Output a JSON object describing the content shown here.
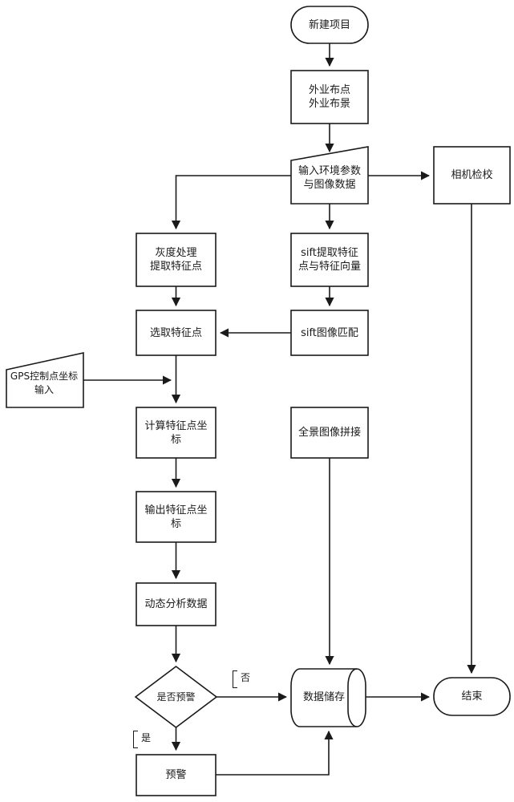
{
  "diagram": {
    "title": "Photogrammetry monitoring workflow flowchart",
    "stroke_color": "#1a1a1a",
    "fill_color": "#ffffff",
    "nodes": [
      {
        "id": "start",
        "label": "新建项目",
        "shape": "terminator"
      },
      {
        "id": "layout",
        "label": "外业布点\n外业布景",
        "shape": "process"
      },
      {
        "id": "input",
        "label": "输入环境参数\n与图像数据",
        "shape": "trapezoid"
      },
      {
        "id": "camera",
        "label": "相机检校",
        "shape": "process"
      },
      {
        "id": "gray",
        "label": "灰度处理\n提取特征点",
        "shape": "process"
      },
      {
        "id": "siftext",
        "label": "sift提取特征\n点与特征向量",
        "shape": "process"
      },
      {
        "id": "select",
        "label": "选取特征点",
        "shape": "process"
      },
      {
        "id": "siftmatch",
        "label": "sift图像匹配",
        "shape": "process"
      },
      {
        "id": "gps",
        "label": "GPS控制点坐标\n输入",
        "shape": "trapezoid"
      },
      {
        "id": "calc",
        "label": "计算特征点坐\n标",
        "shape": "process"
      },
      {
        "id": "output",
        "label": "输出特征点坐\n标",
        "shape": "process"
      },
      {
        "id": "panorama",
        "label": "全景图像拼接",
        "shape": "process"
      },
      {
        "id": "dynamic",
        "label": "动态分析数据",
        "shape": "process"
      },
      {
        "id": "decision",
        "label": "是否预警",
        "shape": "decision"
      },
      {
        "id": "storage",
        "label": "数据储存",
        "shape": "cylinder"
      },
      {
        "id": "warn",
        "label": "预警",
        "shape": "process"
      },
      {
        "id": "end",
        "label": "结束",
        "shape": "terminator"
      }
    ],
    "edge_labels": [
      {
        "id": "no",
        "label": "否",
        "from": "decision",
        "to": "storage"
      },
      {
        "id": "yes",
        "label": "是",
        "from": "decision",
        "to": "warn"
      }
    ]
  }
}
